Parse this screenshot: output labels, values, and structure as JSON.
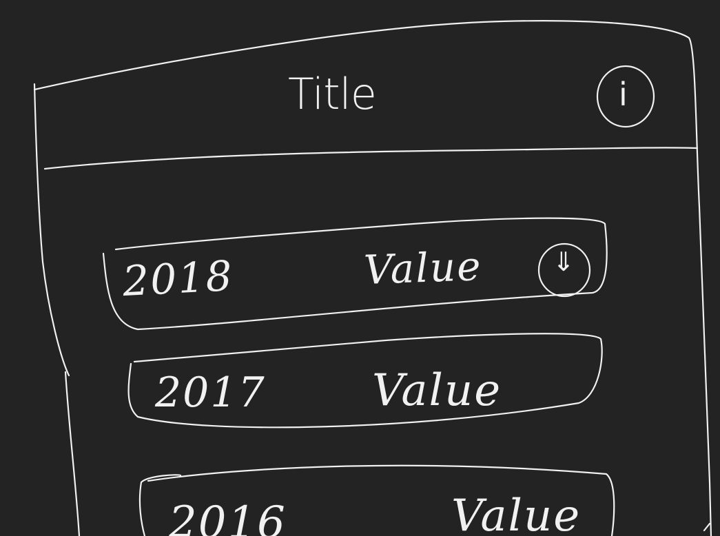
{
  "header": {
    "title": "Title",
    "info_icon": "info-icon",
    "info_glyph": "i"
  },
  "rows": [
    {
      "year": "2018",
      "value": "Value",
      "action_icon": "download-icon",
      "action_glyph": "⇓"
    },
    {
      "year": "2017",
      "value": "Value"
    },
    {
      "year": "2016",
      "value": "Value"
    }
  ],
  "colors": {
    "background": "#232323",
    "ink": "#f1f1f1"
  }
}
